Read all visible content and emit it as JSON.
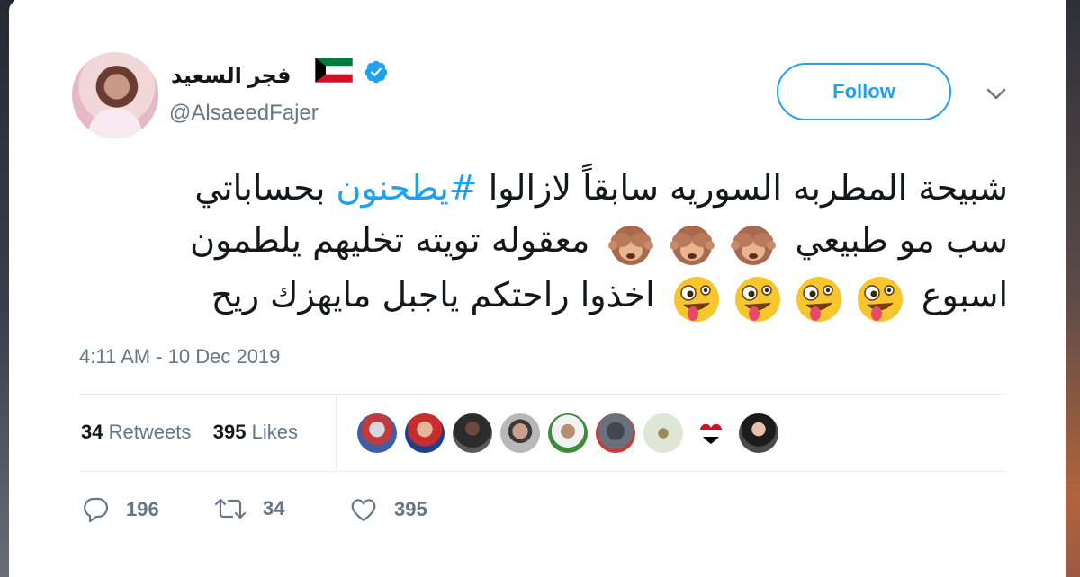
{
  "author": {
    "name": "فجر السعيد",
    "handle": "@AlsaeedFajer",
    "avatar_icon": "profile-photo",
    "flag_icon": "kuwait-flag",
    "verified_icon": "verified-badge"
  },
  "header": {
    "follow_label": "Follow",
    "menu_icon": "chevron-down-icon"
  },
  "tweet": {
    "line1_part1": "شبيحة المطربه السوريه سابقاً لازالوا ",
    "hashtag": "#يطحنون",
    "line1_part2": " بحساباتي",
    "line2_part1": "سب مو طبيعي",
    "line2_part2": "معقوله تويته تخليهم يلطمون",
    "line3_part1": "اسبوع",
    "line3_part2": "اخذوا راحتكم ياجبل مايهزك ريح",
    "emoji_monkey": "see-no-evil-monkey",
    "emoji_zany": "zany-face"
  },
  "meta": {
    "timestamp": "4:11 AM - 10 Dec 2019"
  },
  "stats": {
    "retweets_count": "34",
    "retweets_label": "Retweets",
    "likes_count": "395",
    "likes_label": "Likes"
  },
  "actions": {
    "reply_count": "196",
    "retweet_count": "34",
    "like_count": "395"
  },
  "colors": {
    "accent": "#1da1f2",
    "text": "#14171a",
    "muted": "#657786",
    "divider": "#e6ecf0"
  }
}
